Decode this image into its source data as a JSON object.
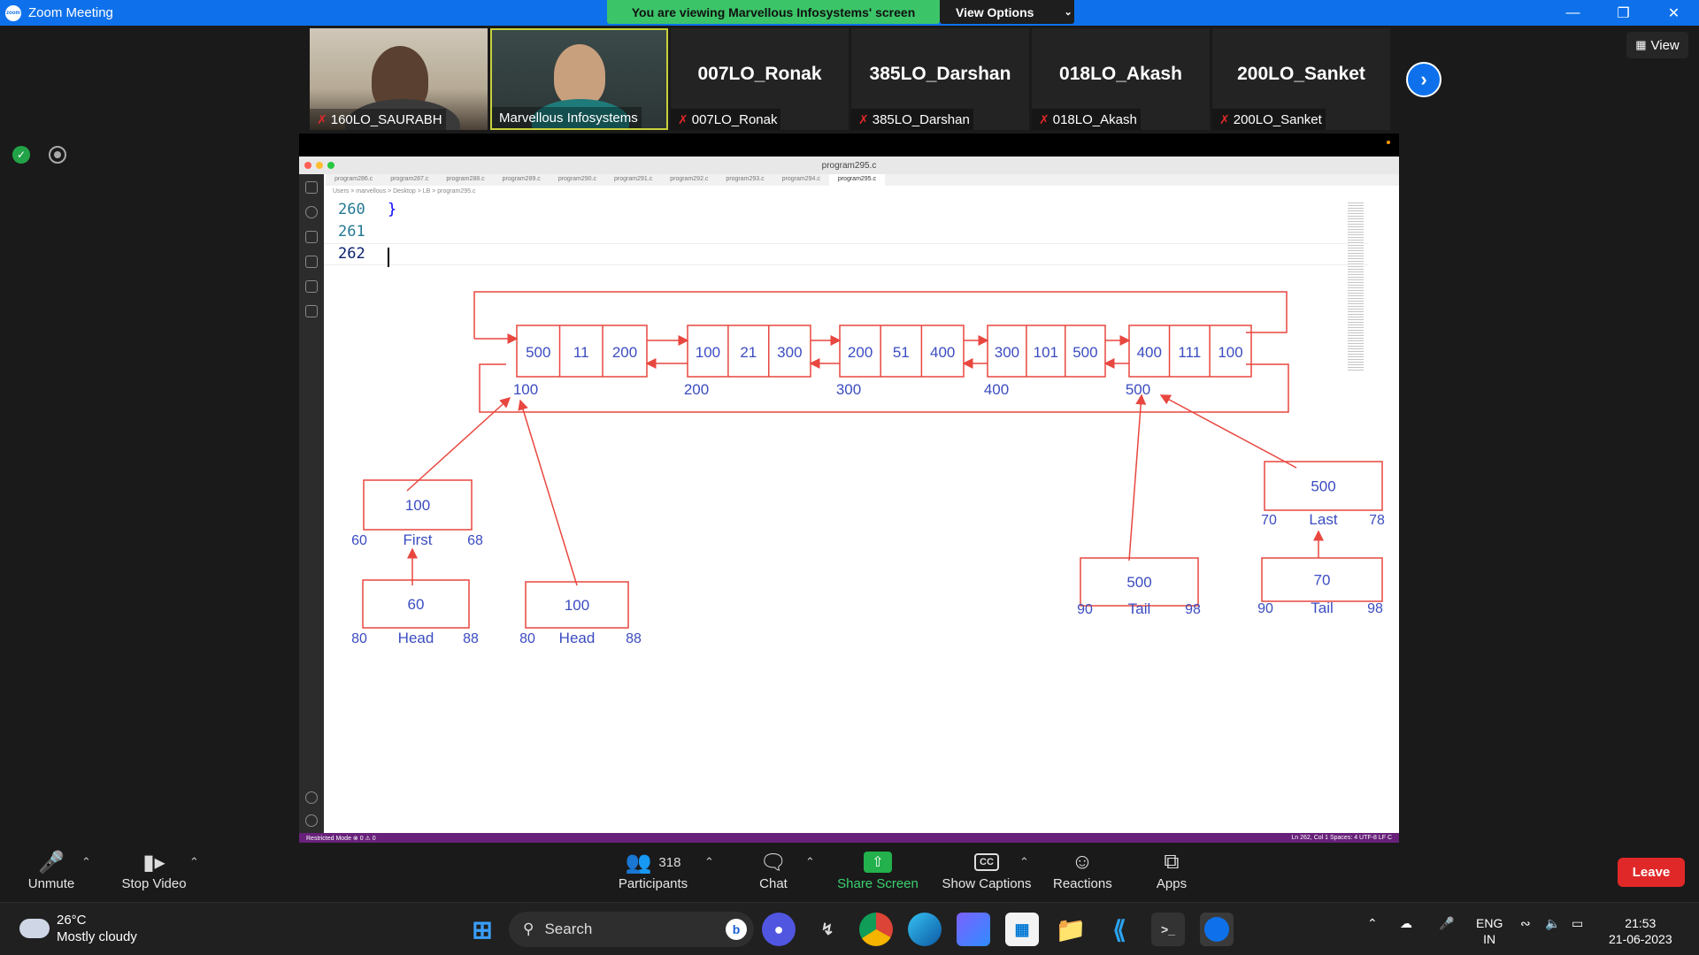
{
  "window": {
    "title": "Zoom Meeting",
    "viewing_banner": "You are viewing Marvellous Infosystems' screen",
    "view_options_label": "View Options"
  },
  "participants_strip": [
    {
      "label": "160LO_SAURABH",
      "has_video": true
    },
    {
      "label": "Marvellous Infosystems",
      "has_video": true
    },
    {
      "name": "007LO_Ronak",
      "label": "007LO_Ronak"
    },
    {
      "name": "385LO_Darshan",
      "label": "385LO_Darshan"
    },
    {
      "name": "018LO_Akash",
      "label": "018LO_Akash"
    },
    {
      "name": "200LO_Sanket",
      "label": "200LO_Sanket"
    }
  ],
  "view_button_label": "View",
  "editor": {
    "window_title": "program295.c",
    "tabs": [
      "program286.c",
      "program287.c",
      "program288.c",
      "program289.c",
      "program290.c",
      "program291.c",
      "program292.c",
      "program293.c",
      "program294.c",
      "program295.c"
    ],
    "breadcrumb": "Users > marvellous > Desktop > LB > program295.c",
    "line_numbers": [
      "260",
      "261",
      "262"
    ],
    "code_lines": [
      "}",
      "",
      ""
    ],
    "status_left": "Restricted Mode   ⊗ 0 ⚠ 0",
    "status_right": "Ln 262, Col 1   Spaces: 4   UTF-8   LF   C"
  },
  "diagram": {
    "nodes": [
      {
        "prev": "500",
        "data": "11",
        "next": "200",
        "address": "100"
      },
      {
        "prev": "100",
        "data": "21",
        "next": "300",
        "address": "200"
      },
      {
        "prev": "200",
        "data": "51",
        "next": "400",
        "address": "300"
      },
      {
        "prev": "300",
        "data": "101",
        "next": "500",
        "address": "400"
      },
      {
        "prev": "400",
        "data": "111",
        "next": "100",
        "address": "500"
      }
    ],
    "pointers": [
      {
        "value": "100",
        "name": "First",
        "start": "60",
        "end": "68"
      },
      {
        "value": "60",
        "name": "Head",
        "start": "80",
        "end": "88"
      },
      {
        "value": "100",
        "name": "Head",
        "start": "80",
        "end": "88"
      },
      {
        "value": "500",
        "name": "Tail",
        "start": "90",
        "end": "98"
      },
      {
        "value": "500",
        "name": "Last",
        "start": "70",
        "end": "78"
      },
      {
        "value": "70",
        "name": "Tail",
        "start": "90",
        "end": "98"
      }
    ]
  },
  "toolbar": {
    "unmute": "Unmute",
    "stop_video": "Stop Video",
    "participants": "Participants",
    "participants_count": "318",
    "chat": "Chat",
    "share_screen": "Share Screen",
    "show_captions": "Show Captions",
    "reactions": "Reactions",
    "apps": "Apps",
    "leave": "Leave"
  },
  "taskbar": {
    "temperature": "26°C",
    "weather": "Mostly cloudy",
    "search": "Search",
    "lang_top": "ENG",
    "lang_bottom": "IN",
    "time": "21:53",
    "date": "21-06-2023"
  },
  "colors": {
    "zoom_blue": "#0e71eb",
    "banner_green": "#3cc469",
    "leave_red": "#e02828",
    "diagram_red": "#e8473f",
    "diagram_blue": "#3b4cc0"
  }
}
